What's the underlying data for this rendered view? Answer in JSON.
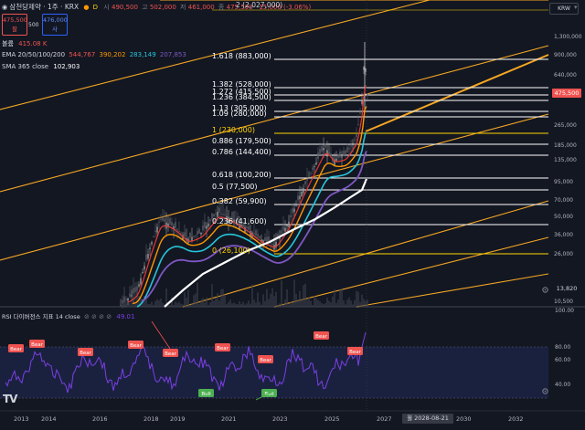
{
  "header": {
    "symbol_label": "삼천당제약 · 1주 · KRX",
    "open_label": "시",
    "open_value": "490,500",
    "high_label": "고",
    "high_value": "502,000",
    "low_label": "저",
    "low_value": "461,000",
    "close_label": "종",
    "close_value": "475,500",
    "change_value": "-15,000 (-3.06%)",
    "sell_price": "475,500",
    "sell_label": "팔",
    "spread": "500",
    "buy_price": "476,000",
    "buy_label": "사",
    "volume_label": "볼륨",
    "volume_value": "415.08 K",
    "ema_label": "EMA 20/50/100/200",
    "ema_values": [
      "544,767",
      "390,202",
      "283,149",
      "207,853"
    ],
    "sma_label": "SMA 365 close",
    "sma_value": "102,903",
    "fib_top_label": "2 (2,027,000)",
    "currency": "KRW",
    "current_price_tag": "475,500",
    "volume_tag": "13,820"
  },
  "fib_levels": [
    {
      "label": "1.618 (883,000)"
    },
    {
      "label": "1.382 (528,000)"
    },
    {
      "label": "1.272 (415,500)"
    },
    {
      "label": "1.236 (384,500)"
    },
    {
      "label": "1.13 (305,000)"
    },
    {
      "label": "1.09 (280,000)"
    },
    {
      "label": "1 (230,000)"
    },
    {
      "label": "0.886 (179,500)"
    },
    {
      "label": "0.786 (144,400)"
    },
    {
      "label": "0.618 (100,200)"
    },
    {
      "label": "0.5 (77,500)"
    },
    {
      "label": "0.382 (59,900)"
    },
    {
      "label": "0.236 (41,600)"
    },
    {
      "label": "0 (26,100)"
    }
  ],
  "price_axis": [
    "1,300,000",
    "900,000",
    "640,000",
    "475,500",
    "265,000",
    "185,000",
    "135,000",
    "95,000",
    "70,000",
    "50,000",
    "36,000",
    "26,000",
    "13,820",
    "10,500"
  ],
  "rsi": {
    "label": "RSI 다이버전스 지표 14 close",
    "value": "49.01",
    "axis": [
      "100.00",
      "80.00",
      "60.00",
      "40.00"
    ],
    "bear_label": "Bear",
    "bull_label": "Bull"
  },
  "time_axis": [
    "2013",
    "2014",
    "2016",
    "2018",
    "2019",
    "2021",
    "2023",
    "2025",
    "2027",
    "2030",
    "2032"
  ],
  "time_cursor": "월 2028-08-21",
  "logo": "TV",
  "colors": {
    "background": "#131722",
    "fib_line": "#ffffff",
    "fib_yellow": "#ffd400",
    "channel": "#f5a623",
    "ema20": "#e53935",
    "ema50": "#ff9800",
    "ema100": "#26c6da",
    "ema200": "#7e57c2",
    "sma365": "#ffffff",
    "rsi_line": "#7b3fe4",
    "bear": "#ef5350",
    "bull": "#4caf50"
  }
}
